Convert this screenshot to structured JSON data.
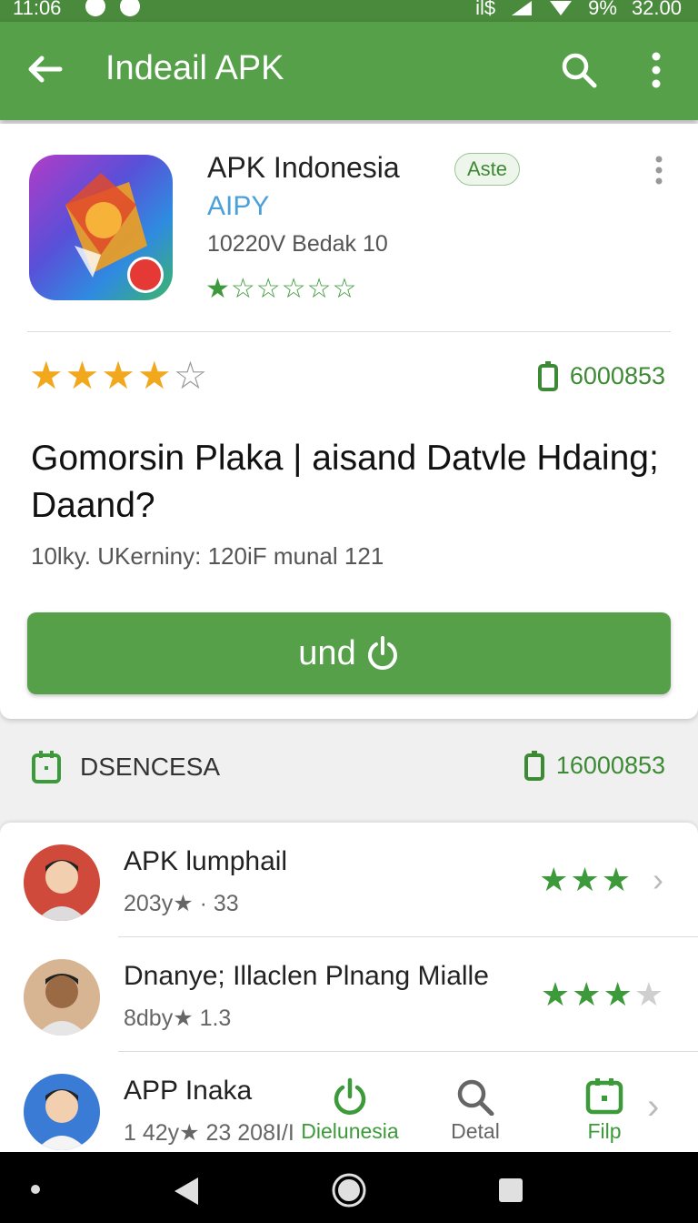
{
  "status_bar": {
    "time_left": "11:06",
    "time_right": "32.00",
    "battery": "9%",
    "signal_text": "il$"
  },
  "app_bar": {
    "title": "Indeail APK"
  },
  "app_card": {
    "name": "APK Indonesia",
    "chip": "Aste",
    "developer": "AIPY",
    "meta": "10220V  Bedak 10",
    "small_stars": "★☆☆☆☆☆",
    "rating_value": 4,
    "download_count": "6000853",
    "headline": "Gomorsin Plaka | aisand Datvle Hdaing; Daand?",
    "subline": "10lky. UKerniny: 120iF munal 121",
    "install_label": "und"
  },
  "section": {
    "title": "DSENCESA",
    "count": "16000853"
  },
  "list": {
    "items": [
      {
        "name": "APK lumphail",
        "sub": "203y★ · 33",
        "stars_filled": "★★★",
        "stars_empty": ""
      },
      {
        "name": "Dnanye; Illaclen Plnang Mialle",
        "sub": "8dby★ 1.3",
        "stars_filled": "★★★",
        "stars_empty": "★"
      },
      {
        "name": "APP Inaka",
        "sub": "1 42y★ 23 208I/I",
        "stars_filled": "",
        "stars_empty": ""
      }
    ]
  },
  "bottom_tabs": {
    "tab1": "Dielunesia",
    "tab2": "Detal",
    "tab3": "Filp"
  },
  "colors": {
    "primary_green": "#56a04a",
    "star_gold": "#f2a81d",
    "link_blue": "#4aa0d8"
  }
}
